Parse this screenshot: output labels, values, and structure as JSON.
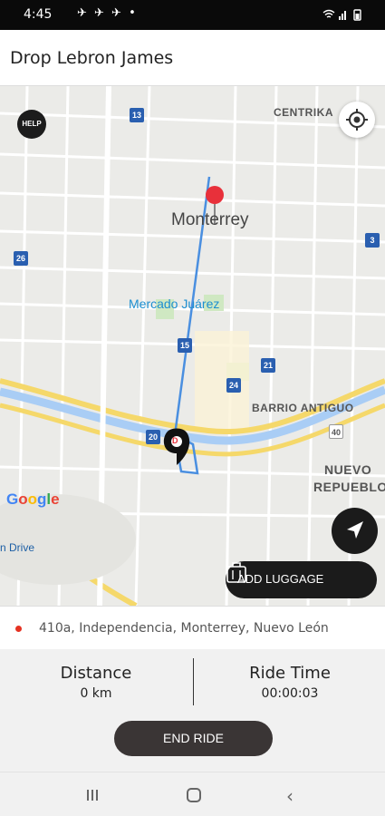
{
  "status_bar": {
    "time": "4:45",
    "notification_icons": "✈ ✈ ✈ •",
    "system_icons": "wifi signal battery"
  },
  "header": {
    "title": "Drop Lebron James"
  },
  "map": {
    "city_label": "Monterrey",
    "poi_label": "Mercado Juárez",
    "district_labels": [
      "CENTRIKA",
      "BARRIO ANTIGUO"
    ],
    "area_label_line1": "NUEVO",
    "area_label_line2": "REPUEBLO",
    "road_label": "n Drive",
    "route_shields": [
      "13",
      "26",
      "3",
      "15",
      "21",
      "24",
      "20",
      "40"
    ],
    "google_logo": [
      "G",
      "o",
      "o",
      "g",
      "l",
      "e"
    ],
    "help_label": "HELP",
    "destination_marker": "D",
    "colors": {
      "route": "#4a8fe0",
      "pin": "#e8303a",
      "major_road": "#f5d86a",
      "water": "#a9cdf5"
    }
  },
  "luggage_button": {
    "label": "ADD LUGGAGE"
  },
  "address": {
    "text": "410a, Independencia, Monterrey, Nuevo León"
  },
  "stats": {
    "distance_title": "Distance",
    "distance_value": "0 km",
    "ride_time_title": "Ride Time",
    "ride_time_value": "00:00:03"
  },
  "end_ride_button": {
    "label": "END RIDE"
  },
  "nav_bar": {
    "back_glyph": "‹"
  }
}
